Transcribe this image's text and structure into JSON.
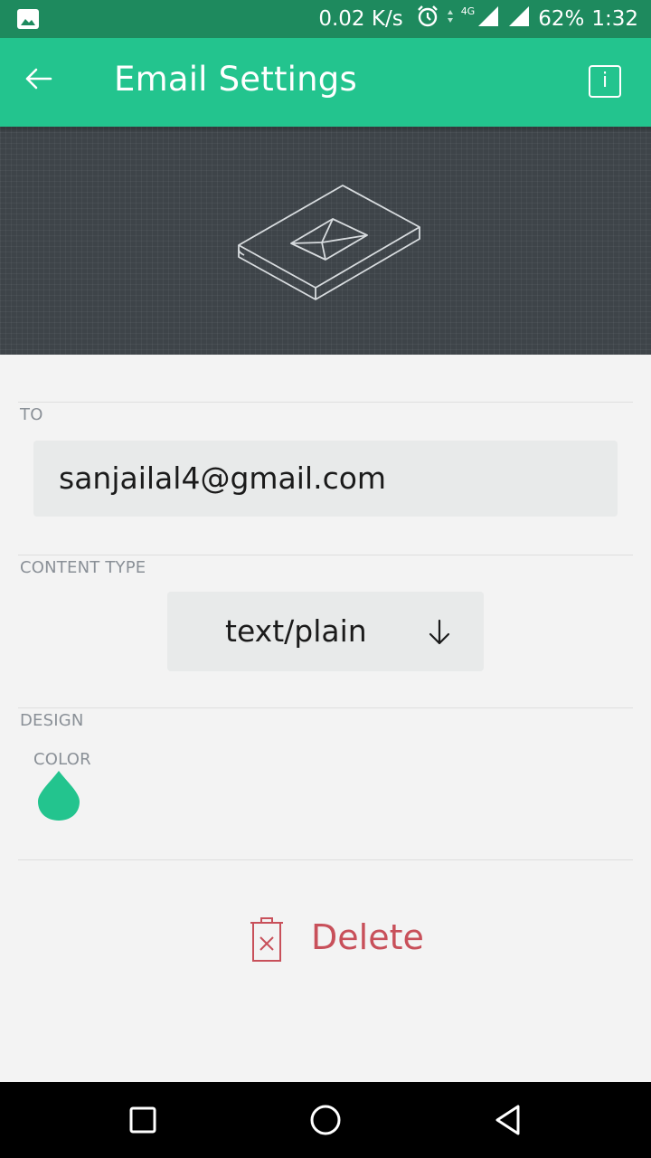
{
  "status_bar": {
    "net_speed": "0.02 K/s",
    "network_type": "4G",
    "battery": "62%",
    "time": "1:32",
    "icons": [
      "gallery-icon",
      "alarm-icon",
      "data-arrows-icon",
      "signal-icon",
      "signal-icon-2"
    ]
  },
  "app_bar": {
    "title": "Email Settings",
    "back_icon": "arrow-left-icon",
    "info_label": "i"
  },
  "hero": {
    "icon": "email-widget-icon"
  },
  "to": {
    "label": "TO",
    "value": "sanjailal4@gmail.com"
  },
  "content_type": {
    "label": "CONTENT TYPE",
    "selected": "text/plain",
    "icon": "arrow-down-icon"
  },
  "design": {
    "label": "DESIGN",
    "color_label": "COLOR",
    "color_value": "#23c48e"
  },
  "delete": {
    "label": "Delete",
    "icon": "trash-icon",
    "color": "#c8505a"
  },
  "nav_bar": {
    "buttons": [
      "recents-square-icon",
      "home-circle-icon",
      "back-triangle-icon"
    ]
  }
}
